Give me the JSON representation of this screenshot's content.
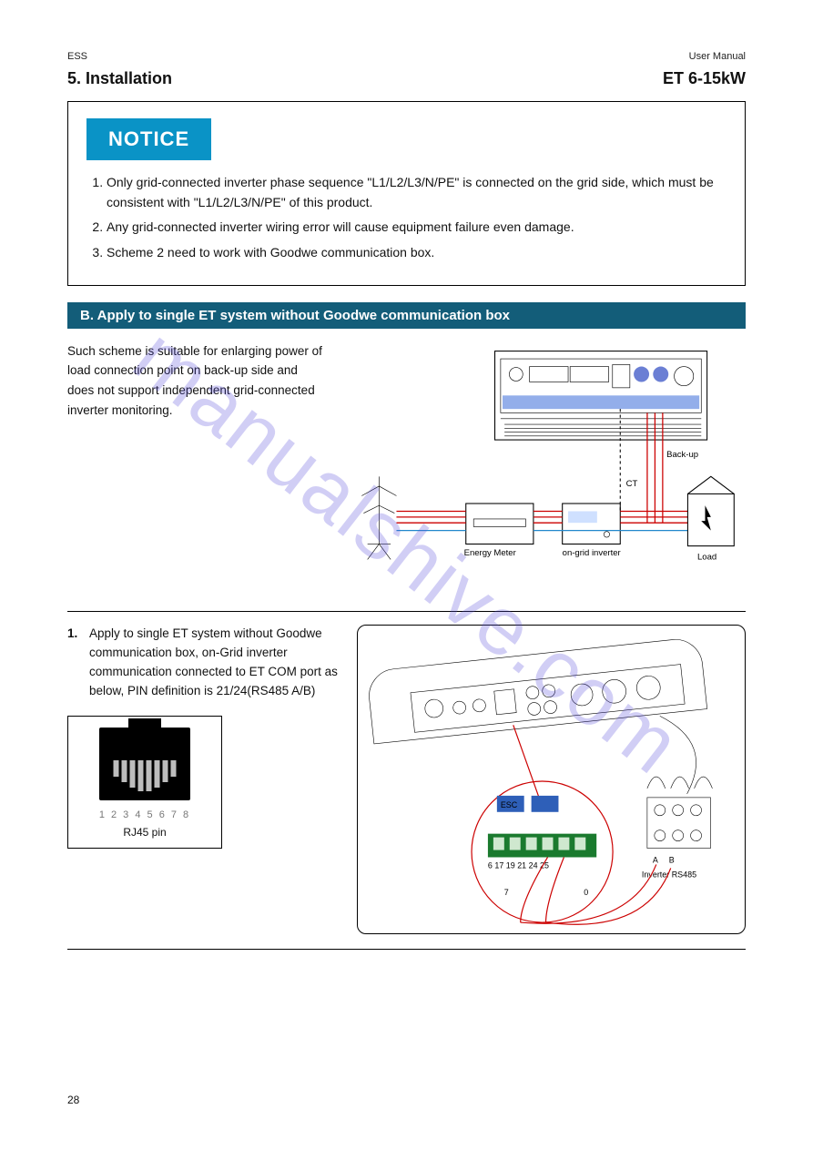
{
  "header": {
    "left": "ESS",
    "right": "User Manual"
  },
  "title": "5. Installation",
  "model_range": "ET 6-15kW",
  "notice": {
    "badge": "NOTICE",
    "items": [
      "Only grid-connected inverter phase sequence \"L1/L2/L3/N/PE\" is connected on the grid side, which must be consistent with \"L1/L2/L3/N/PE\" of this product.",
      "Any grid-connected inverter wiring error will cause equipment failure even damage.",
      "Scheme 2 need to work with Goodwe communication box."
    ]
  },
  "section_title": "B. Apply to single ET system without Goodwe communication box",
  "intro_text": "Such scheme is suitable for enlarging power of load connection point on back-up side and does not support independent grid-connected inverter monitoring.",
  "diagram_labels": {
    "ongrid": "on-grid inverter",
    "backup": "Back-up",
    "energy_meter": "Energy Meter",
    "load": "Load",
    "ct": "CT"
  },
  "step1": {
    "num": "1.",
    "text": "Apply to single ET system without Goodwe communication box, on-Grid inverter communication connected to ET COM port as below, PIN definition is 21/24(RS485 A/B)"
  },
  "rj45": {
    "pins": "1 2 3 4 5 6 7 8",
    "caption": "RJ45 pin"
  },
  "detail_labels": {
    "terminal_numbers": "6 17 19 21 24 25",
    "small_7": "7",
    "small_0": "0",
    "a": "A",
    "b": "B",
    "rs485": "Inverter RS485"
  },
  "footer": {
    "page": "28"
  },
  "watermark": "manualshive.com"
}
